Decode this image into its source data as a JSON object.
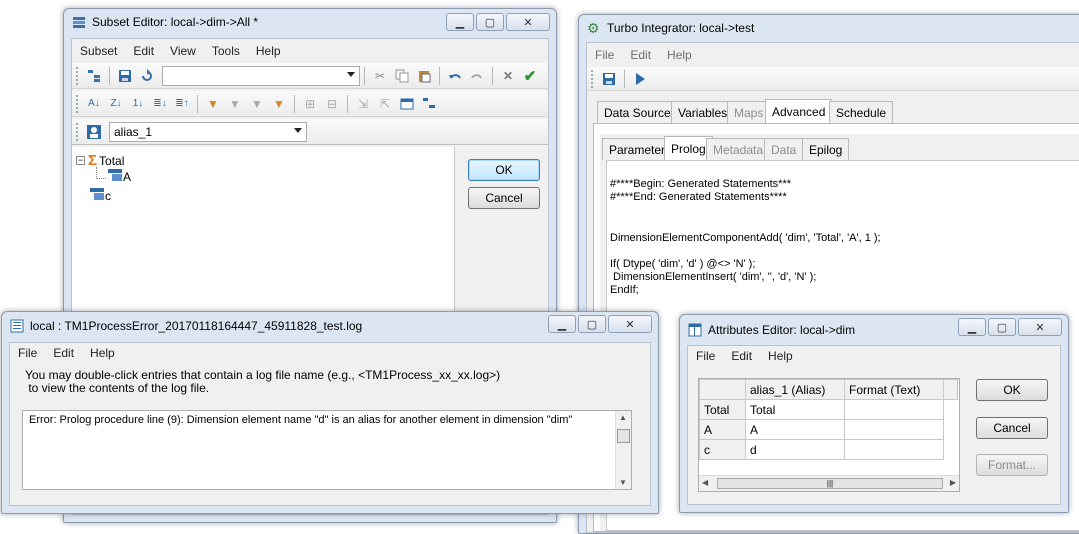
{
  "subset_editor": {
    "title": "Subset Editor:  local->dim->All  *",
    "menu": [
      "Subset",
      "Edit",
      "View",
      "Tools",
      "Help"
    ],
    "alias_value": "alias_1",
    "tree": {
      "root": "Total",
      "child": "A",
      "other": "c"
    },
    "ok_label": "OK",
    "cancel_label": "Cancel"
  },
  "turbo_integrator": {
    "title": "Turbo Integrator:  local->test",
    "menu": [
      "File",
      "Edit",
      "Help"
    ],
    "tabs": [
      "Data Source",
      "Variables",
      "Maps",
      "Advanced",
      "Schedule"
    ],
    "subtabs": [
      "Parameters",
      "Prolog",
      "Metadata",
      "Data",
      "Epilog"
    ],
    "code_lines": [
      "#****Begin: Generated Statements***",
      "#****End: Generated Statements****",
      "",
      "",
      "DimensionElementComponentAdd( 'dim', 'Total', 'A', 1 );",
      "",
      "If( Dtype( 'dim', 'd' ) @<> 'N' );",
      " DimensionElementInsert( 'dim', '', 'd', 'N' );",
      "EndIf;"
    ]
  },
  "log_window": {
    "title": "local : TM1ProcessError_20170118164447_45911828_test.log",
    "menu": [
      "File",
      "Edit",
      "Help"
    ],
    "hint_line1": "You may double-click entries that contain a log file name (e.g., <TM1Process_xx_xx.log>)",
    "hint_line2": " to view the contents of the log file.",
    "error_text": "Error: Prolog procedure line (9): Dimension element name \"d\" is an alias for another element in dimension \"dim\""
  },
  "attributes_editor": {
    "title": "Attributes Editor: local->dim",
    "menu": [
      "File",
      "Edit",
      "Help"
    ],
    "columns": [
      "alias_1 (Alias)",
      "Format (Text)"
    ],
    "rows": [
      {
        "element": "Total",
        "alias": "Total",
        "format": ""
      },
      {
        "element": "A",
        "alias": "A",
        "format": ""
      },
      {
        "element": "c",
        "alias": "d",
        "format": ""
      }
    ],
    "ok_label": "OK",
    "cancel_label": "Cancel",
    "format_label": "Format..."
  }
}
